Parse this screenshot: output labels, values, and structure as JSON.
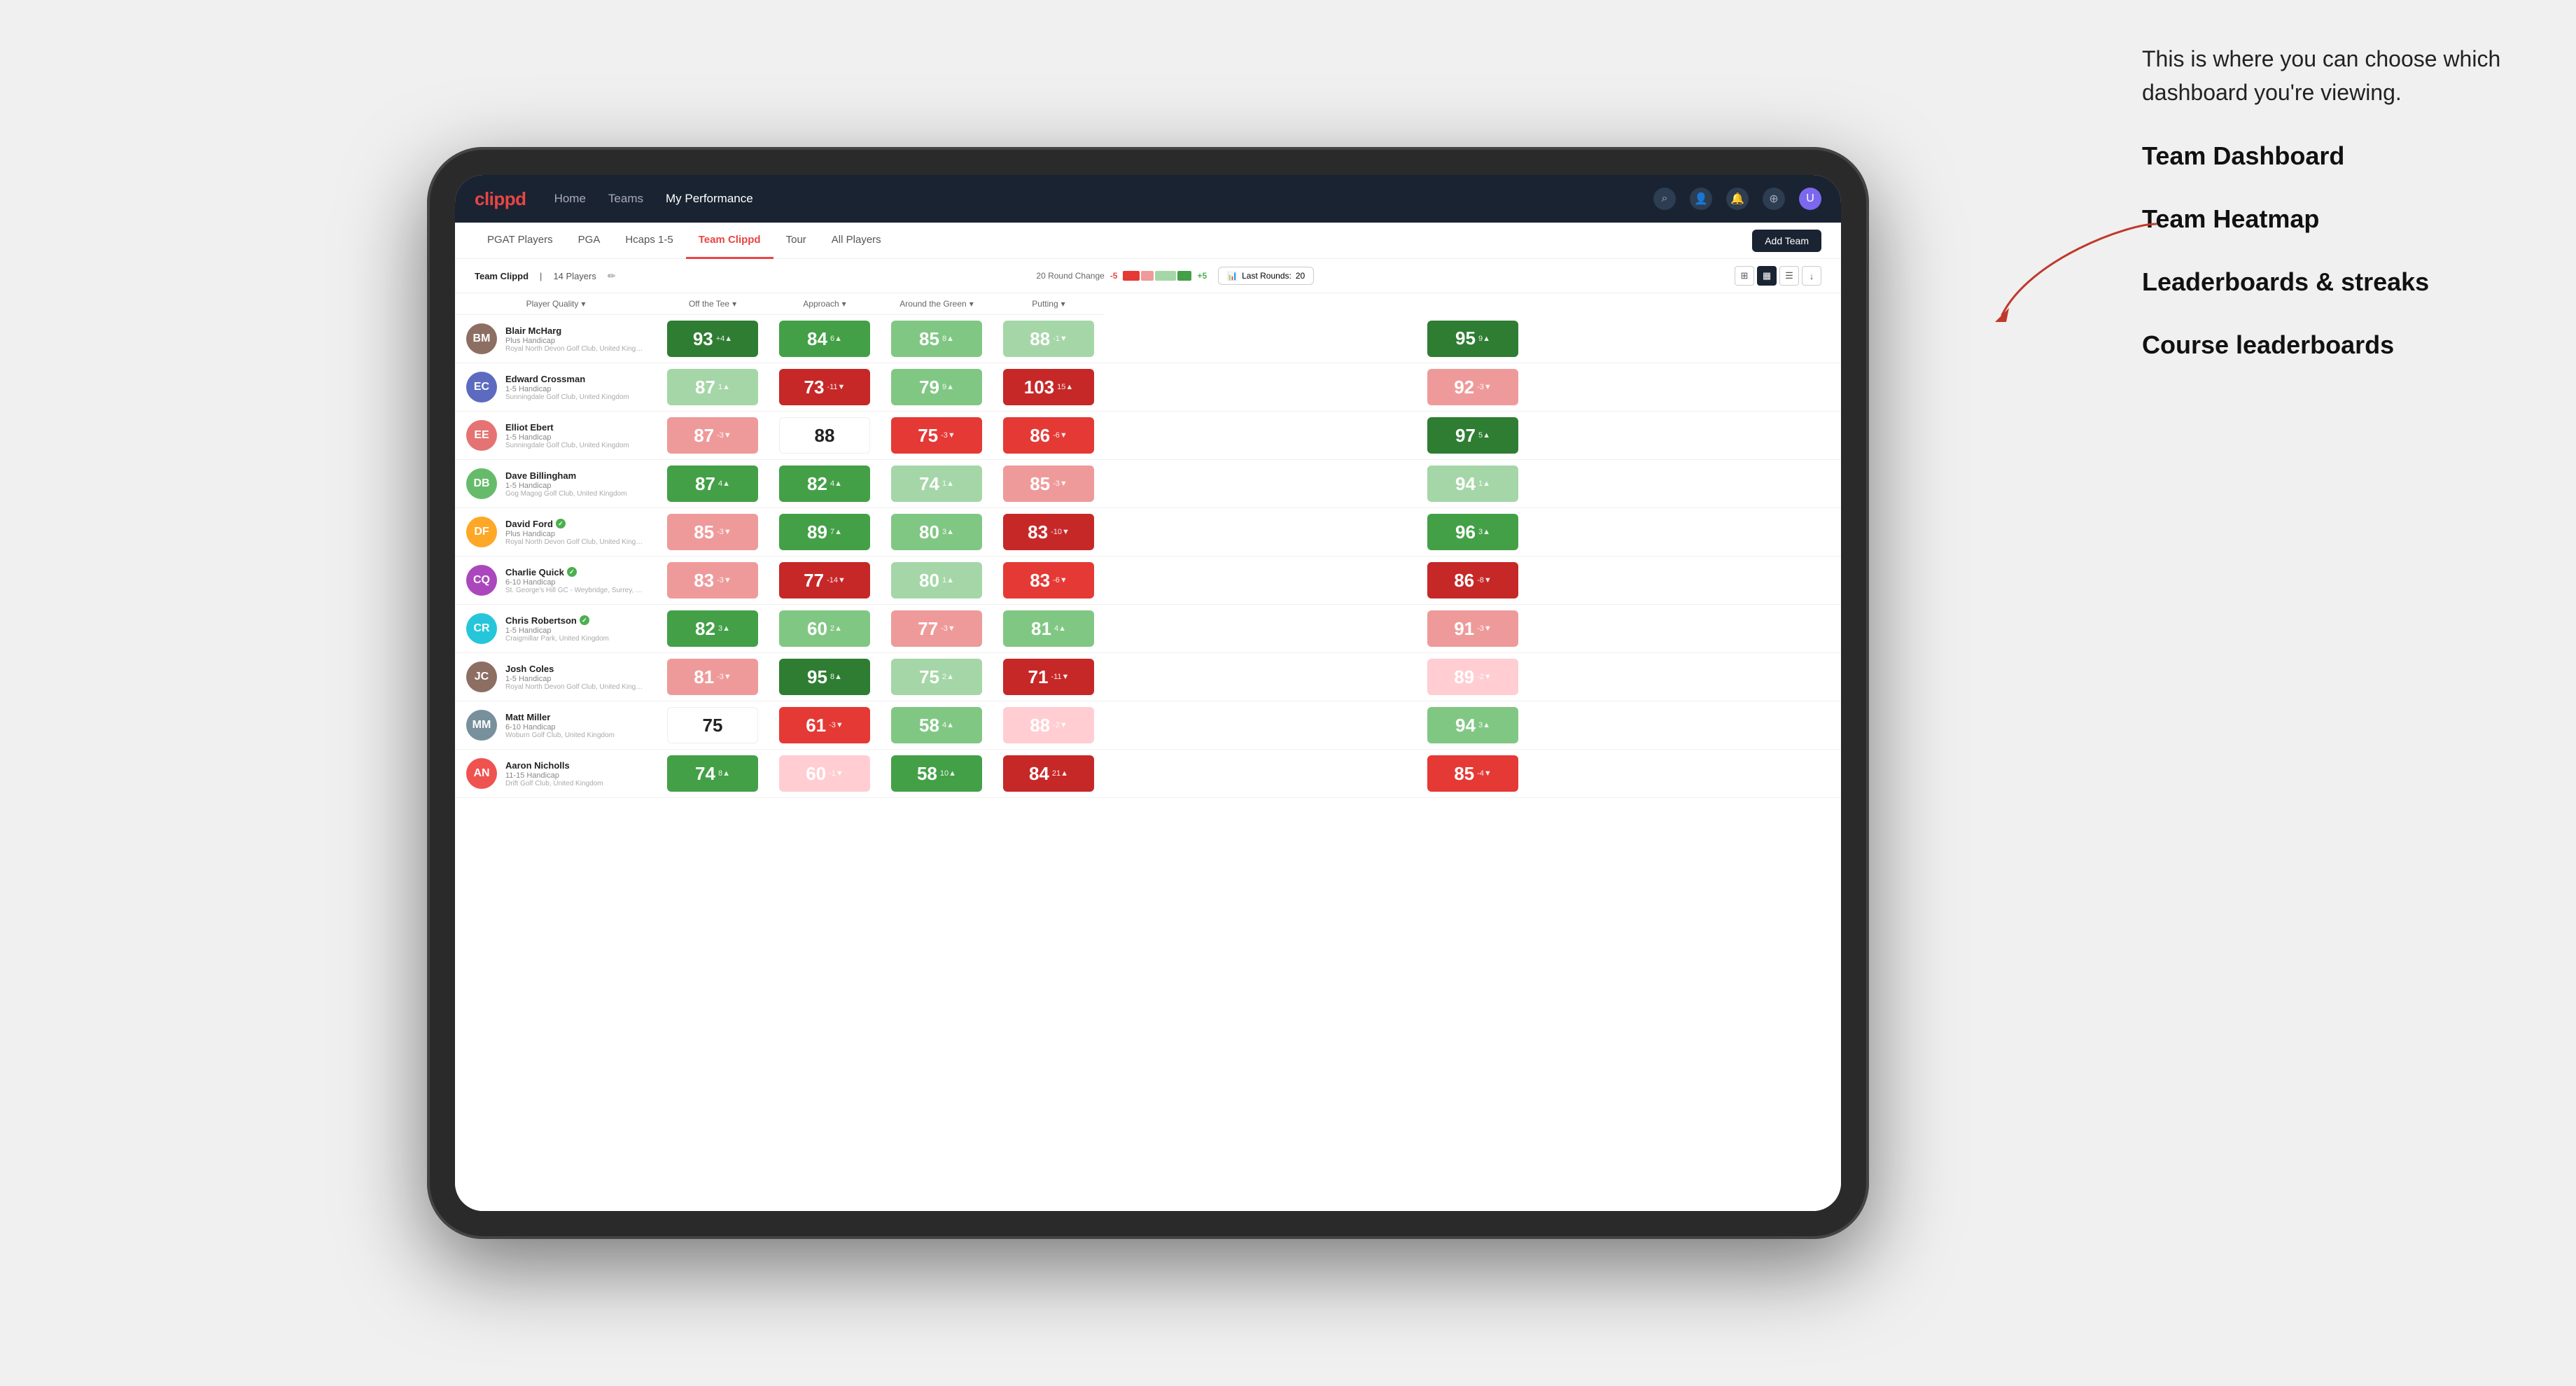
{
  "annotation": {
    "intro": "This is where you can choose which dashboard you're viewing.",
    "items": [
      "Team Dashboard",
      "Team Heatmap",
      "Leaderboards & streaks",
      "Course leaderboards"
    ]
  },
  "nav": {
    "logo": "clippd",
    "links": [
      "Home",
      "Teams",
      "My Performance"
    ],
    "active_link": "My Performance"
  },
  "sub_nav": {
    "tabs": [
      "PGAT Players",
      "PGA",
      "Hcaps 1-5",
      "Team Clippd",
      "Tour",
      "All Players"
    ],
    "active_tab": "Team Clippd",
    "add_team_label": "Add Team"
  },
  "team_bar": {
    "team_name": "Team Clippd",
    "player_count": "14 Players",
    "round_change_label": "20 Round Change",
    "change_neg": "-5",
    "change_pos": "+5",
    "last_rounds_label": "Last Rounds:",
    "last_rounds_value": "20"
  },
  "table": {
    "headers": {
      "player": "Player Quality",
      "off_tee": "Off the Tee",
      "approach": "Approach",
      "around_green": "Around the Green",
      "putting": "Putting"
    },
    "players": [
      {
        "name": "Blair McHarg",
        "handicap": "Plus Handicap",
        "club": "Royal North Devon Golf Club, United Kingdom",
        "avatar_color": "#8d6e63",
        "initials": "BM",
        "scores": {
          "quality": {
            "value": 93,
            "change": "+4",
            "dir": "up",
            "bg": "bg-green-dark"
          },
          "off_tee": {
            "value": 84,
            "change": "6",
            "dir": "up",
            "bg": "bg-green-mid"
          },
          "approach": {
            "value": 85,
            "change": "8",
            "dir": "up",
            "bg": "bg-green-light"
          },
          "around_green": {
            "value": 88,
            "change": "-1",
            "dir": "down",
            "bg": "bg-green-pale"
          },
          "putting": {
            "value": 95,
            "change": "9",
            "dir": "up",
            "bg": "bg-green-dark"
          }
        }
      },
      {
        "name": "Edward Crossman",
        "handicap": "1-5 Handicap",
        "club": "Sunningdale Golf Club, United Kingdom",
        "avatar_color": "#5c6bc0",
        "initials": "EC",
        "scores": {
          "quality": {
            "value": 87,
            "change": "1",
            "dir": "up",
            "bg": "bg-green-pale"
          },
          "off_tee": {
            "value": 73,
            "change": "-11",
            "dir": "down",
            "bg": "bg-red-dark"
          },
          "approach": {
            "value": 79,
            "change": "9",
            "dir": "up",
            "bg": "bg-green-light"
          },
          "around_green": {
            "value": 103,
            "change": "15",
            "dir": "up",
            "bg": "bg-red-dark"
          },
          "putting": {
            "value": 92,
            "change": "-3",
            "dir": "down",
            "bg": "bg-red-light"
          }
        }
      },
      {
        "name": "Elliot Ebert",
        "handicap": "1-5 Handicap",
        "club": "Sunningdale Golf Club, United Kingdom",
        "avatar_color": "#e57373",
        "initials": "EE",
        "scores": {
          "quality": {
            "value": 87,
            "change": "-3",
            "dir": "down",
            "bg": "bg-red-light"
          },
          "off_tee": {
            "value": 88,
            "change": "",
            "dir": "",
            "bg": "white"
          },
          "approach": {
            "value": 75,
            "change": "-3",
            "dir": "down",
            "bg": "bg-red-mid"
          },
          "around_green": {
            "value": 86,
            "change": "-6",
            "dir": "down",
            "bg": "bg-red-mid"
          },
          "putting": {
            "value": 97,
            "change": "5",
            "dir": "up",
            "bg": "bg-green-dark"
          }
        }
      },
      {
        "name": "Dave Billingham",
        "handicap": "1-5 Handicap",
        "club": "Gog Magog Golf Club, United Kingdom",
        "avatar_color": "#66bb6a",
        "initials": "DB",
        "scores": {
          "quality": {
            "value": 87,
            "change": "4",
            "dir": "up",
            "bg": "bg-green-mid"
          },
          "off_tee": {
            "value": 82,
            "change": "4",
            "dir": "up",
            "bg": "bg-green-mid"
          },
          "approach": {
            "value": 74,
            "change": "1",
            "dir": "up",
            "bg": "bg-green-pale"
          },
          "around_green": {
            "value": 85,
            "change": "-3",
            "dir": "down",
            "bg": "bg-red-light"
          },
          "putting": {
            "value": 94,
            "change": "1",
            "dir": "up",
            "bg": "bg-green-pale"
          }
        }
      },
      {
        "name": "David Ford",
        "handicap": "Plus Handicap",
        "club": "Royal North Devon Golf Club, United Kingdom",
        "avatar_color": "#ffa726",
        "initials": "DF",
        "verified": true,
        "scores": {
          "quality": {
            "value": 85,
            "change": "-3",
            "dir": "down",
            "bg": "bg-red-light"
          },
          "off_tee": {
            "value": 89,
            "change": "7",
            "dir": "up",
            "bg": "bg-green-mid"
          },
          "approach": {
            "value": 80,
            "change": "3",
            "dir": "up",
            "bg": "bg-green-light"
          },
          "around_green": {
            "value": 83,
            "change": "-10",
            "dir": "down",
            "bg": "bg-red-dark"
          },
          "putting": {
            "value": 96,
            "change": "3",
            "dir": "up",
            "bg": "bg-green-mid"
          }
        }
      },
      {
        "name": "Charlie Quick",
        "handicap": "6-10 Handicap",
        "club": "St. George's Hill GC - Weybridge, Surrey, Uni...",
        "avatar_color": "#ab47bc",
        "initials": "CQ",
        "verified": true,
        "scores": {
          "quality": {
            "value": 83,
            "change": "-3",
            "dir": "down",
            "bg": "bg-red-light"
          },
          "off_tee": {
            "value": 77,
            "change": "-14",
            "dir": "down",
            "bg": "bg-red-dark"
          },
          "approach": {
            "value": 80,
            "change": "1",
            "dir": "up",
            "bg": "bg-green-pale"
          },
          "around_green": {
            "value": 83,
            "change": "-6",
            "dir": "down",
            "bg": "bg-red-mid"
          },
          "putting": {
            "value": 86,
            "change": "-8",
            "dir": "down",
            "bg": "bg-red-dark"
          }
        }
      },
      {
        "name": "Chris Robertson",
        "handicap": "1-5 Handicap",
        "club": "Craigmillar Park, United Kingdom",
        "avatar_color": "#26c6da",
        "initials": "CR",
        "verified": true,
        "scores": {
          "quality": {
            "value": 82,
            "change": "3",
            "dir": "up",
            "bg": "bg-green-mid"
          },
          "off_tee": {
            "value": 60,
            "change": "2",
            "dir": "up",
            "bg": "bg-green-light"
          },
          "approach": {
            "value": 77,
            "change": "-3",
            "dir": "down",
            "bg": "bg-red-light"
          },
          "around_green": {
            "value": 81,
            "change": "4",
            "dir": "up",
            "bg": "bg-green-light"
          },
          "putting": {
            "value": 91,
            "change": "-3",
            "dir": "down",
            "bg": "bg-red-light"
          }
        }
      },
      {
        "name": "Josh Coles",
        "handicap": "1-5 Handicap",
        "club": "Royal North Devon Golf Club, United Kingdom",
        "avatar_color": "#8d6e63",
        "initials": "JC",
        "scores": {
          "quality": {
            "value": 81,
            "change": "-3",
            "dir": "down",
            "bg": "bg-red-light"
          },
          "off_tee": {
            "value": 95,
            "change": "8",
            "dir": "up",
            "bg": "bg-green-dark"
          },
          "approach": {
            "value": 75,
            "change": "2",
            "dir": "up",
            "bg": "bg-green-pale"
          },
          "around_green": {
            "value": 71,
            "change": "-11",
            "dir": "down",
            "bg": "bg-red-dark"
          },
          "putting": {
            "value": 89,
            "change": "-2",
            "dir": "down",
            "bg": "bg-red-pale"
          }
        }
      },
      {
        "name": "Matt Miller",
        "handicap": "6-10 Handicap",
        "club": "Woburn Golf Club, United Kingdom",
        "avatar_color": "#78909c",
        "initials": "MM",
        "scores": {
          "quality": {
            "value": 75,
            "change": "",
            "dir": "",
            "bg": "white"
          },
          "off_tee": {
            "value": 61,
            "change": "-3",
            "dir": "down",
            "bg": "bg-red-mid"
          },
          "approach": {
            "value": 58,
            "change": "4",
            "dir": "up",
            "bg": "bg-green-light"
          },
          "around_green": {
            "value": 88,
            "change": "-2",
            "dir": "down",
            "bg": "bg-red-pale"
          },
          "putting": {
            "value": 94,
            "change": "3",
            "dir": "up",
            "bg": "bg-green-light"
          }
        }
      },
      {
        "name": "Aaron Nicholls",
        "handicap": "11-15 Handicap",
        "club": "Drift Golf Club, United Kingdom",
        "avatar_color": "#ef5350",
        "initials": "AN",
        "scores": {
          "quality": {
            "value": 74,
            "change": "8",
            "dir": "up",
            "bg": "bg-green-mid"
          },
          "off_tee": {
            "value": 60,
            "change": "-1",
            "dir": "down",
            "bg": "bg-red-pale"
          },
          "approach": {
            "value": 58,
            "change": "10",
            "dir": "up",
            "bg": "bg-green-mid"
          },
          "around_green": {
            "value": 84,
            "change": "21",
            "dir": "up",
            "bg": "bg-red-dark"
          },
          "putting": {
            "value": 85,
            "change": "-4",
            "dir": "down",
            "bg": "bg-red-mid"
          }
        }
      }
    ]
  }
}
